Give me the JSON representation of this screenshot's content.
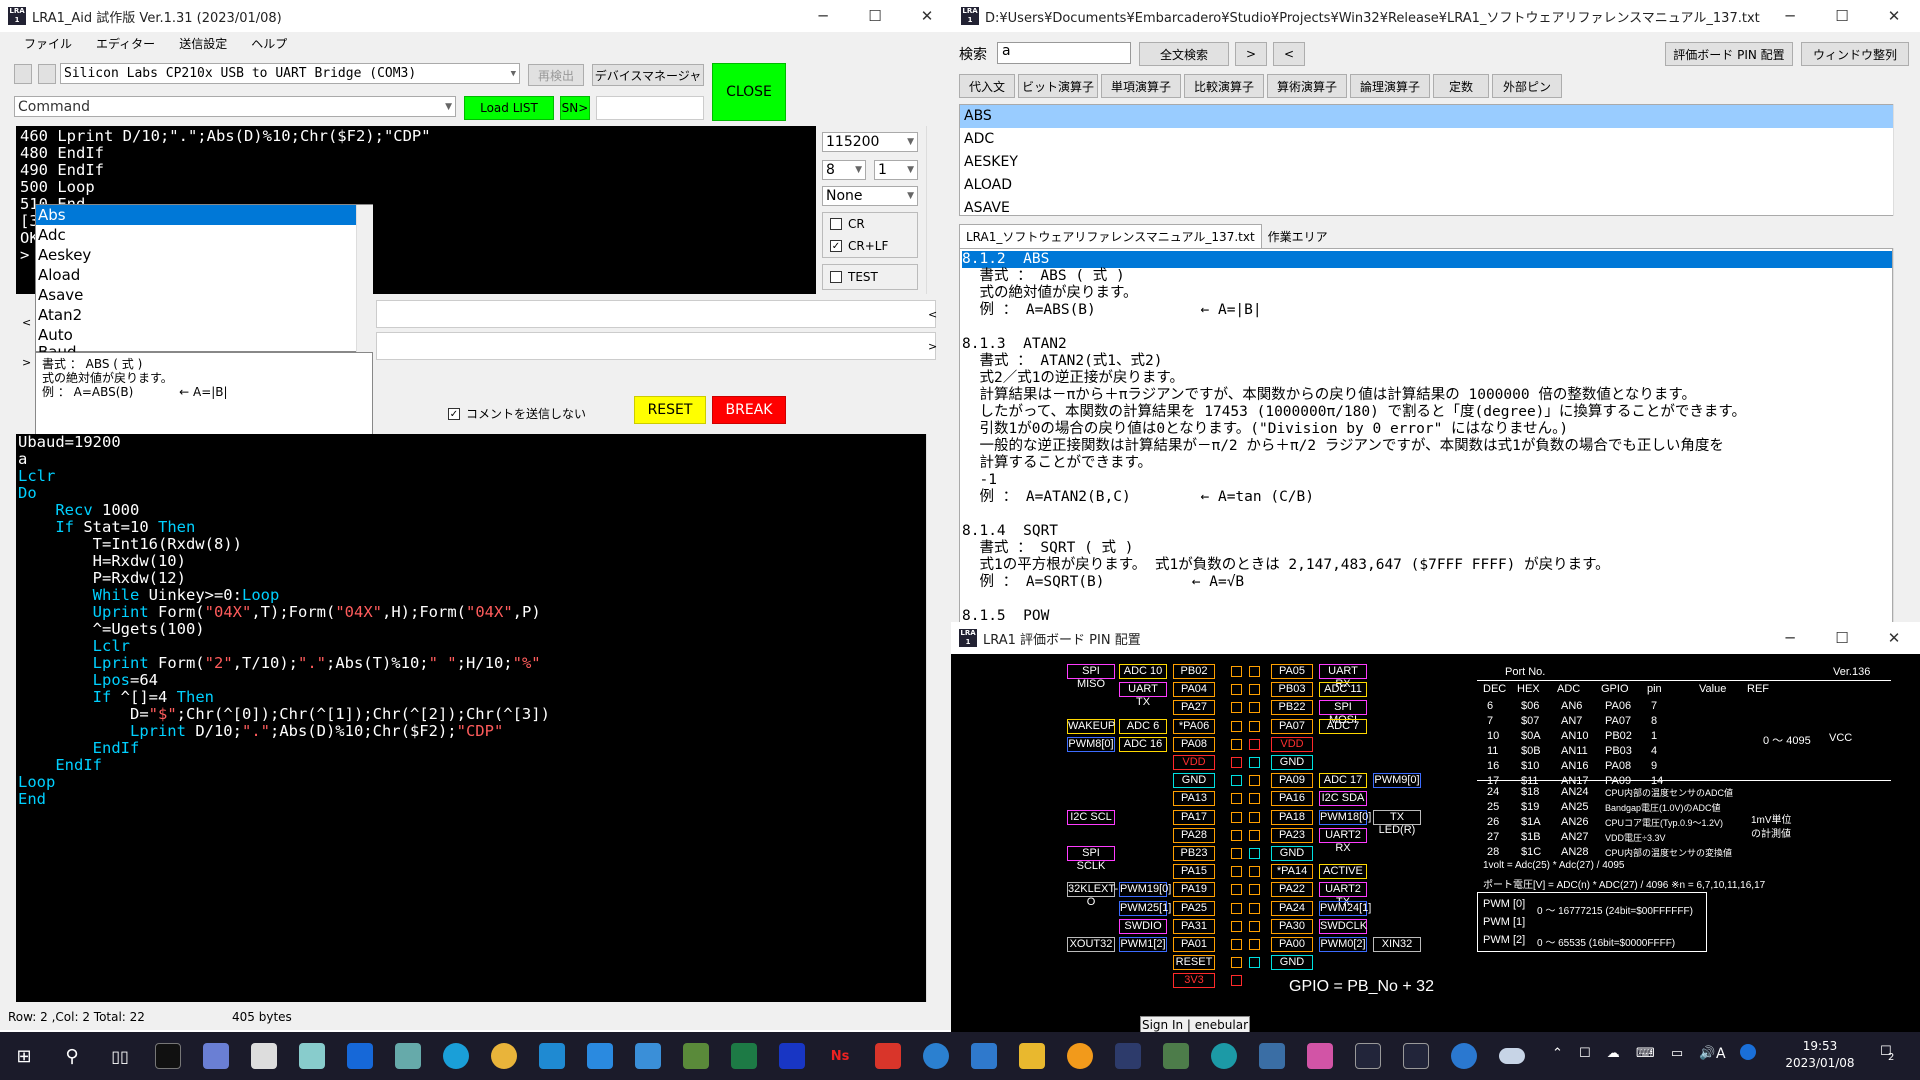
{
  "left": {
    "title": "LRA1_Aid 試作版 Ver.1.31 (2023/01/08)",
    "menu": [
      "ファイル",
      "エディター",
      "送信設定",
      "ヘルプ"
    ],
    "port": "Silicon Labs CP210x USB to UART Bridge (COM3)",
    "btn_redetect": "再検出",
    "btn_devmgr": "デバイスマネージャ",
    "btn_close": "CLOSE",
    "command": "Command",
    "btn_loadlist": "Load LIST",
    "btn_sn": "SN>",
    "baud": "115200",
    "databits": "8",
    "stopbits": "1",
    "parity": "None",
    "cr": "CR",
    "crlf": "CR+LF",
    "test": "TEST",
    "terminal_lines": [
      "460 Lprint D/10;\".\";Abs(D)%10;Chr($F2);\"CDP\"",
      "480 EndIf",
      "490 EndIf",
      "500 Loop",
      "510 End",
      "[3",
      "OK",
      "> "
    ],
    "popup_items": [
      "Abs",
      "Adc",
      "Aeskey",
      "Aload",
      "Asave",
      "Atan2",
      "Auto",
      "Baud"
    ],
    "popup_help": [
      "書式 ： ABS ( 式 )",
      "式の絶対値が戻ります。",
      "例 ： A=ABS(B)            ← A=|B|"
    ],
    "no_comment": "コメントを送信しない",
    "btn_reset": "RESET",
    "btn_break": "BREAK",
    "status_pos": "Row: 2 ,Col: 2 Total: 22",
    "status_bytes": "405 bytes"
  },
  "code_lines": [
    [
      [
        "",
        "Ubaud=19200"
      ]
    ],
    [
      [
        "",
        "a"
      ]
    ],
    [
      [
        "kw",
        "Lclr"
      ]
    ],
    [
      [
        "kw",
        "Do"
      ]
    ],
    [
      [
        "",
        "    "
      ],
      [
        "kw",
        "Recv "
      ],
      [
        "",
        "1000"
      ]
    ],
    [
      [
        "",
        "    "
      ],
      [
        "kw",
        "If "
      ],
      [
        "",
        "Stat=10 "
      ],
      [
        "kw",
        "Then"
      ]
    ],
    [
      [
        "",
        "        T=Int16(Rxdw(8))"
      ]
    ],
    [
      [
        "",
        "        H=Rxdw(10)"
      ]
    ],
    [
      [
        "",
        "        P=Rxdw(12)"
      ]
    ],
    [
      [
        "",
        "        "
      ],
      [
        "kw",
        "While "
      ],
      [
        "",
        "Uinkey>=0:"
      ],
      [
        "kw",
        "Loop"
      ]
    ],
    [
      [
        "",
        "        "
      ],
      [
        "kw",
        "Uprint "
      ],
      [
        "",
        "Form("
      ],
      [
        "str",
        "\"04X\""
      ],
      [
        "",
        ",T);Form("
      ],
      [
        "str",
        "\"04X\""
      ],
      [
        "",
        ",H);Form("
      ],
      [
        "str",
        "\"04X\""
      ],
      [
        "",
        ",P)"
      ]
    ],
    [
      [
        "",
        "        ^=Ugets(100)"
      ]
    ],
    [
      [
        "",
        "        "
      ],
      [
        "kw",
        "Lclr"
      ]
    ],
    [
      [
        "",
        "        "
      ],
      [
        "kw",
        "Lprint "
      ],
      [
        "",
        "Form("
      ],
      [
        "str",
        "\"2\""
      ],
      [
        "",
        ",T/10);"
      ],
      [
        "str",
        "\".\""
      ],
      [
        "",
        ";Abs(T)%10;"
      ],
      [
        "str",
        "\" \""
      ],
      [
        "",
        ";H/10;"
      ],
      [
        "str",
        "\"%\""
      ]
    ],
    [
      [
        "",
        "        "
      ],
      [
        "kw",
        "Lpos"
      ],
      [
        "",
        "=64"
      ]
    ],
    [
      [
        "",
        "        "
      ],
      [
        "kw",
        "If "
      ],
      [
        "",
        "^[]=4 "
      ],
      [
        "kw",
        "Then"
      ]
    ],
    [
      [
        "",
        "            D="
      ],
      [
        "str",
        "\"$\""
      ],
      [
        "",
        ";Chr(^[0]);Chr(^[1]);Chr(^[2]);Chr(^[3])"
      ]
    ],
    [
      [
        "",
        "            "
      ],
      [
        "kw",
        "Lprint "
      ],
      [
        "",
        "D/10;"
      ],
      [
        "str",
        "\".\""
      ],
      [
        "",
        ";Abs(D)%10;Chr($F2);"
      ],
      [
        "str",
        "\"CDP\""
      ]
    ],
    [
      [
        "",
        "        "
      ],
      [
        "kw",
        "EndIf"
      ]
    ],
    [
      [
        "",
        "    "
      ],
      [
        "kw",
        "EndIf"
      ]
    ],
    [
      [
        "kw",
        "Loop"
      ]
    ],
    [
      [
        "kw",
        "End"
      ]
    ]
  ],
  "right": {
    "title": "D:¥Users¥Documents¥Embarcadero¥Studio¥Projects¥Win32¥Release¥LRA1_ソフトウェアリファレンスマニュアル_137.txt",
    "search_label": "検索",
    "search_value": "a",
    "btn_fullsearch": "全文検索",
    "btn_next": ">",
    "btn_prev": "<",
    "btn_pinmap": "評価ボード PIN 配置",
    "btn_arrange": "ウィンドウ整列",
    "categories": [
      "代入文",
      "ビット演算子",
      "単項演算子",
      "比較演算子",
      "算術演算子",
      "論理演算子",
      "定数",
      "外部ピン"
    ],
    "list": [
      "ABS",
      "ADC",
      "AESKEY",
      "ALOAD",
      "ASAVE"
    ],
    "tabs": [
      "LRA1_ソフトウェアリファレンスマニュアル_137.txt",
      "作業エリア"
    ],
    "doc_lines": [
      "8.1.2  ABS",
      "  書式 ： ABS ( 式 )",
      "  式の絶対値が戻ります。",
      "  例 ： A=ABS(B)            ← A=|B|",
      "",
      "8.1.3  ATAN2",
      "  書式 ： ATAN2(式1、式2)",
      "  式2／式1の逆正接が戻ります。",
      "  計算結果は－πから＋πラジアンですが、本関数からの戻り値は計算結果の 1000000 倍の整数値となります。",
      "  したがって、本関数の計算結果を 17453 (1000000π/180) で割ると「度(degree)」に換算することができます。",
      "  引数1が0の場合の戻り値は0となります。(\"Division by 0 error\" にはなりません。)",
      "  一般的な逆正接関数は計算結果が－π/2 から＋π/2 ラジアンですが、本関数は式1が負数の場合でも正しい角度を",
      "  計算することができます。",
      "  -1",
      "  例 ： A=ATAN2(B,C)        ← A=tan (C/B)",
      "",
      "8.1.4  SQRT",
      "  書式 ： SQRT ( 式 )",
      "  式1の平方根が戻ります。 式1が負数のときは 2,147,483,647 ($7FFF FFFF) が戻ります。",
      "  例 ： A=SQRT(B)          ← A=√B",
      "",
      "8.1.5  POW"
    ]
  },
  "pinwin": {
    "title": "LRA1 評価ボード PIN 配置",
    "port_no": "Port No.",
    "ver": "Ver.136",
    "headers": [
      "DEC",
      "HEX",
      "ADC",
      "GPIO",
      "pin",
      "Value",
      "REF"
    ],
    "rows": [
      [
        "6",
        "$06",
        "AN6",
        "PA06",
        "7"
      ],
      [
        "7",
        "$07",
        "AN7",
        "PA07",
        "8"
      ],
      [
        "10",
        "$0A",
        "AN10",
        "PB02",
        "1"
      ],
      [
        "11",
        "$0B",
        "AN11",
        "PB03",
        "4"
      ],
      [
        "16",
        "$10",
        "AN16",
        "PA08",
        "9"
      ],
      [
        "17",
        "$11",
        "AN17",
        "PA09",
        "14"
      ]
    ],
    "value_range": "0 ～ 4095",
    "ref_vcc": "VCC",
    "rows2": [
      [
        "24",
        "$18",
        "AN24",
        "CPU内部の温度センサのADC値"
      ],
      [
        "25",
        "$19",
        "AN25",
        "Bandgap電圧(1.0V)のADC値"
      ],
      [
        "26",
        "$1A",
        "AN26",
        "CPUコア電圧(Typ.0.9～1.2V)"
      ],
      [
        "27",
        "$1B",
        "AN27",
        "VDD電圧÷3.3V"
      ],
      [
        "28",
        "$1C",
        "AN28",
        "CPU内部の温度センサの変換値"
      ]
    ],
    "unit_note": "1mV単位の計測値",
    "formula1": "1volt = Adc(25) * Adc(27) / 4095",
    "formula2": "ポート電圧[V] = ADC(n) * ADC(27) / 4096  ※n = 6,7,10,11,16,17",
    "pwm": [
      [
        "PWM [0]",
        "0 ～ 16777215 (24bit=$00FFFFFF)"
      ],
      [
        "PWM [1]",
        ""
      ],
      [
        "PWM [2]",
        "0 ～ 65535 (16bit=$0000FFFF)"
      ]
    ],
    "gpio_note": "GPIO = PB_No + 32",
    "pins_left": [
      [
        "SPI MISO",
        "ADC 10",
        "PB02"
      ],
      [
        "",
        "UART TX",
        "PA04"
      ],
      [
        "",
        "",
        "PA27"
      ],
      [
        "WAKEUP",
        "ADC 6",
        "*PA06"
      ],
      [
        "PWM8[0]",
        "ADC 16",
        "PA08"
      ],
      [
        "",
        "",
        "VDD"
      ],
      [
        "",
        "",
        "GND"
      ],
      [
        "",
        "",
        "PA13"
      ],
      [
        "I2C SCL",
        "",
        "PA17"
      ],
      [
        "",
        "",
        "PA28"
      ],
      [
        "SPI SCLK",
        "",
        "PB23"
      ],
      [
        "",
        "",
        "PA15"
      ],
      [
        "32KLEXT-O",
        "PWM19[0]",
        "PA19"
      ],
      [
        "",
        "PWM25[1]",
        "PA25"
      ],
      [
        "",
        "SWDIO",
        "PA31"
      ],
      [
        "XOUT32",
        "PWM1[2]",
        "PA01"
      ],
      [
        "",
        "",
        "RESET"
      ],
      [
        "",
        "",
        "3V3"
      ]
    ],
    "pins_right": [
      [
        "PA05",
        "UART RX",
        ""
      ],
      [
        "PB03",
        "ADC 11",
        ""
      ],
      [
        "PB22",
        "SPI MOSI",
        ""
      ],
      [
        "PA07",
        "ADC 7",
        ""
      ],
      [
        "VDD",
        "",
        ""
      ],
      [
        "GND",
        "",
        ""
      ],
      [
        "PA09",
        "ADC 17",
        "PWM9[0]"
      ],
      [
        "PA16",
        "I2C SDA",
        ""
      ],
      [
        "PA18",
        "PWM18[0]",
        "TX LED(R)"
      ],
      [
        "PA23",
        "UART2 RX",
        ""
      ],
      [
        "GND",
        "",
        ""
      ],
      [
        "*PA14",
        "ACTIVE",
        ""
      ],
      [
        "PA22",
        "UART2 TX",
        ""
      ],
      [
        "PA24",
        "PWM24[1]",
        ""
      ],
      [
        "PA30",
        "SWDCLK",
        ""
      ],
      [
        "PA00",
        "PWM0[2]",
        "XIN32"
      ],
      [
        "GND",
        "",
        ""
      ]
    ]
  },
  "signin": "Sign In | enebular",
  "clock": {
    "time": "19:53",
    "date": "2023/01/08"
  },
  "tray_lang": "A",
  "notify_count": "2"
}
